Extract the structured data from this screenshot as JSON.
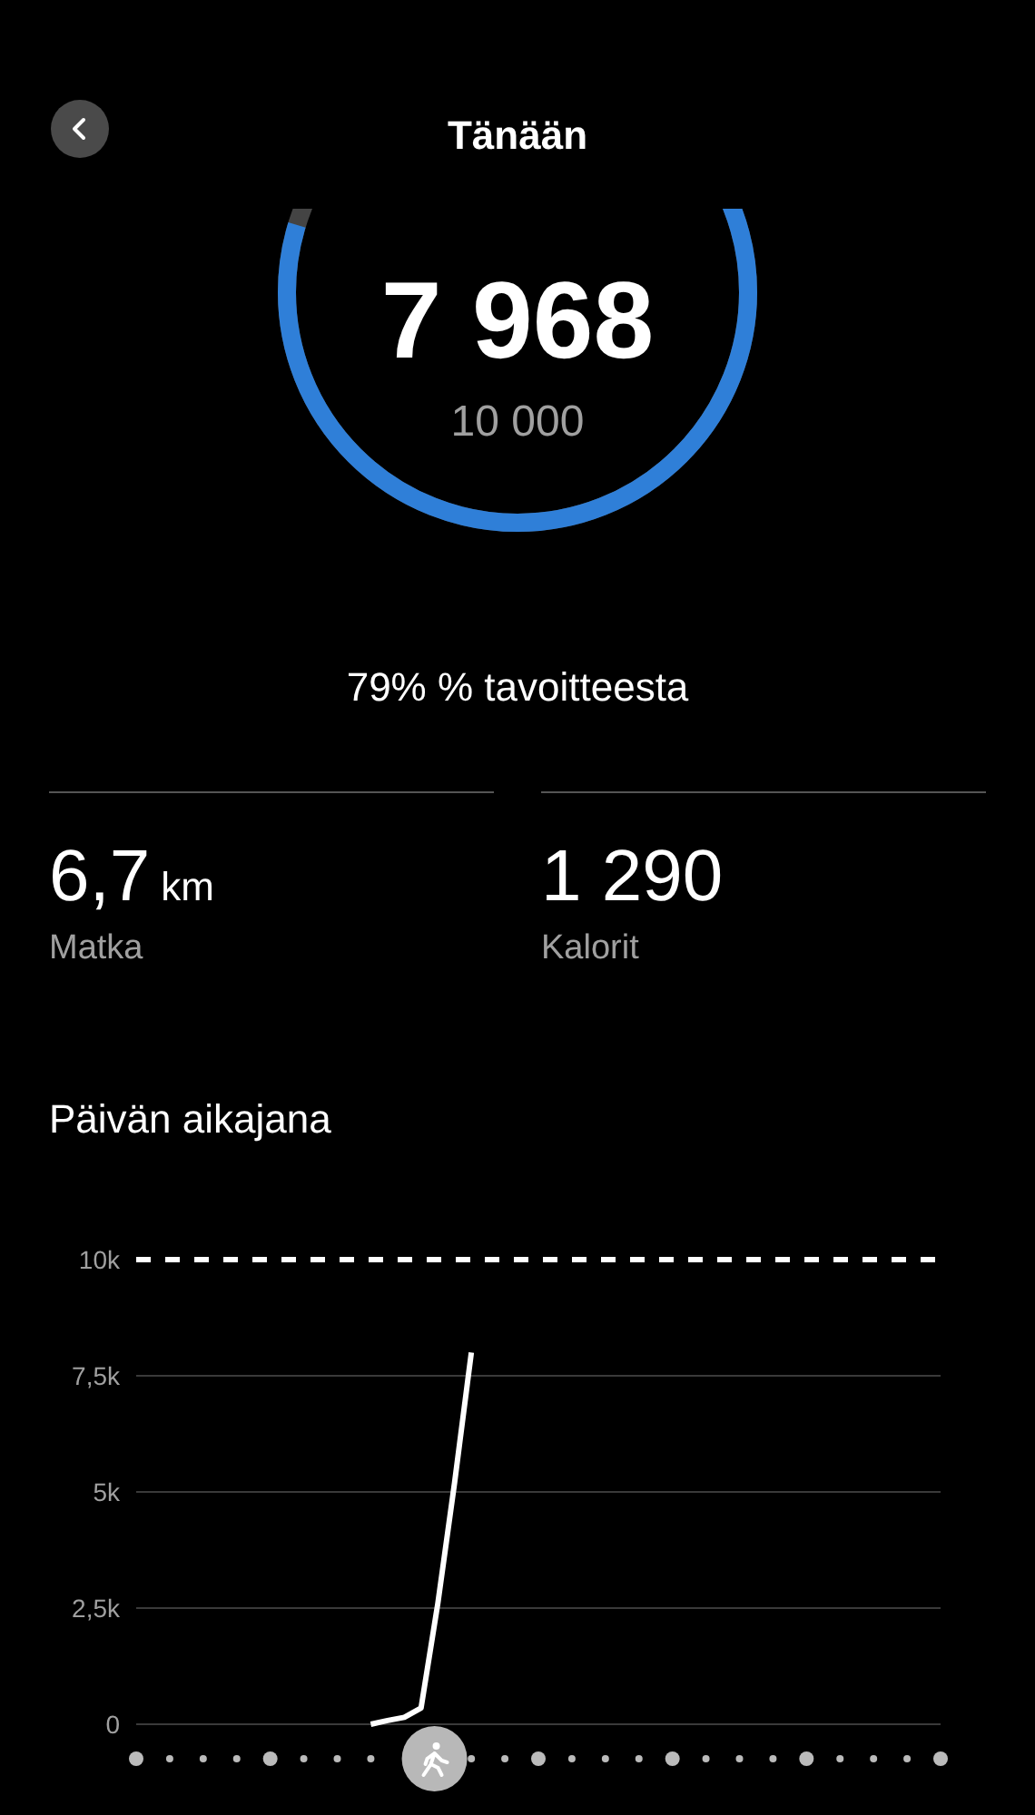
{
  "header": {
    "title": "Tänään"
  },
  "steps": {
    "count": "7 968",
    "goal": "10 000"
  },
  "progress_text": "79% % tavoitteesta",
  "stats": [
    {
      "value": "6,7",
      "unit": "km",
      "label": "Matka"
    },
    {
      "value": "1 290",
      "label": "Kalorit"
    }
  ],
  "timeline": {
    "title": "Päivän aikajana",
    "chart_data": {
      "type": "line",
      "grid": true,
      "ylim": [
        0,
        10000
      ],
      "yticks": [
        {
          "value": 0,
          "label": "0"
        },
        {
          "value": 2500,
          "label": "2,5k"
        },
        {
          "value": 5000,
          "label": "5k"
        },
        {
          "value": 7500,
          "label": "7,5k"
        },
        {
          "value": 10000,
          "label": "10k"
        }
      ],
      "categories": [
        null,
        null,
        null,
        null,
        null,
        null,
        null,
        null,
        null,
        null,
        null,
        null,
        null,
        null,
        null,
        null,
        null,
        null,
        null,
        null,
        null,
        null,
        null,
        null,
        null,
        null,
        null,
        null,
        null,
        null,
        null,
        null,
        null,
        null,
        null,
        null,
        null,
        null,
        null,
        null,
        null,
        null,
        null,
        null,
        null,
        null,
        null,
        null,
        null
      ],
      "series": [
        {
          "color": "#ffffff",
          "values": [
            null,
            null,
            null,
            null,
            null,
            null,
            null,
            null,
            null,
            null,
            null,
            null,
            null,
            null,
            0,
            80,
            150,
            350,
            2600,
            5200,
            8000,
            null,
            null,
            null,
            null,
            null,
            null,
            null,
            null,
            null,
            null,
            null,
            null,
            null,
            null,
            null,
            null,
            null,
            null,
            null,
            null,
            null,
            null,
            null,
            null,
            null,
            null,
            null,
            null
          ]
        }
      ]
    }
  }
}
